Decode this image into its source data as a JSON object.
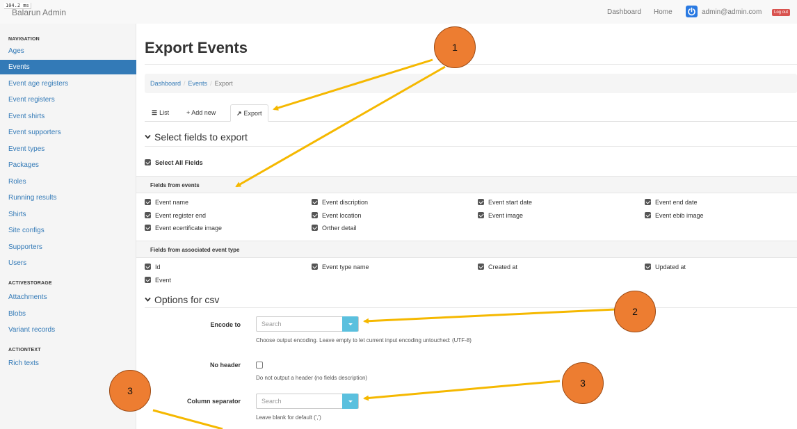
{
  "perf_badge": "104.2 ms",
  "brand": "Balarun Admin",
  "topnav": {
    "dashboard": "Dashboard",
    "home": "Home",
    "user": "admin@admin.com",
    "logout": "Log out"
  },
  "sidebar": {
    "nav_heading": "NAVIGATION",
    "nav_items": [
      "Ages",
      "Events",
      "Event age registers",
      "Event registers",
      "Event shirts",
      "Event supporters",
      "Event types",
      "Packages",
      "Roles",
      "Running results",
      "Shirts",
      "Site configs",
      "Supporters",
      "Users"
    ],
    "active_item": "Events",
    "storage_heading": "ACTIVESTORAGE",
    "storage_items": [
      "Attachments",
      "Blobs",
      "Variant records"
    ],
    "text_heading": "ACTIONTEXT",
    "text_items": [
      "Rich texts"
    ]
  },
  "page": {
    "title": "Export Events"
  },
  "breadcrumb": {
    "dashboard": "Dashboard",
    "events": "Events",
    "current": "Export"
  },
  "tabs": {
    "list": "List",
    "add": "+ Add new",
    "export": "Export"
  },
  "fields_section": {
    "title": "Select fields to export",
    "select_all": "Select All Fields",
    "events_group": "Fields from events",
    "events_fields": [
      "Event name",
      "Event discription",
      "Event start date",
      "Event end date",
      "Event register end",
      "Event location",
      "Event image",
      "Event ebib image",
      "Event ecertificate image",
      "Orther detail"
    ],
    "type_group": "Fields from associated event type",
    "type_fields": [
      "Id",
      "Event type name",
      "Created at",
      "Updated at",
      "Event"
    ]
  },
  "csv_section": {
    "title": "Options for csv",
    "encode_label": "Encode to",
    "encode_placeholder": "Search",
    "encode_help": "Choose output encoding. Leave empty to let current input encoding untouched: (UTF-8)",
    "noheader_label": "No header",
    "noheader_help": "Do not output a header (no fields description)",
    "separator_label": "Column separator",
    "separator_placeholder": "Search",
    "separator_help": "Leave blank for default (',')"
  },
  "annotations": {
    "callout_1": "1",
    "callout_2": "2",
    "callout_3a": "3",
    "callout_3b": "3"
  },
  "colors": {
    "accent": "#337ab7",
    "callout": "#ed7d31",
    "arrow": "#f5b800",
    "logout": "#d9534f",
    "select_btn": "#5bc0de"
  }
}
